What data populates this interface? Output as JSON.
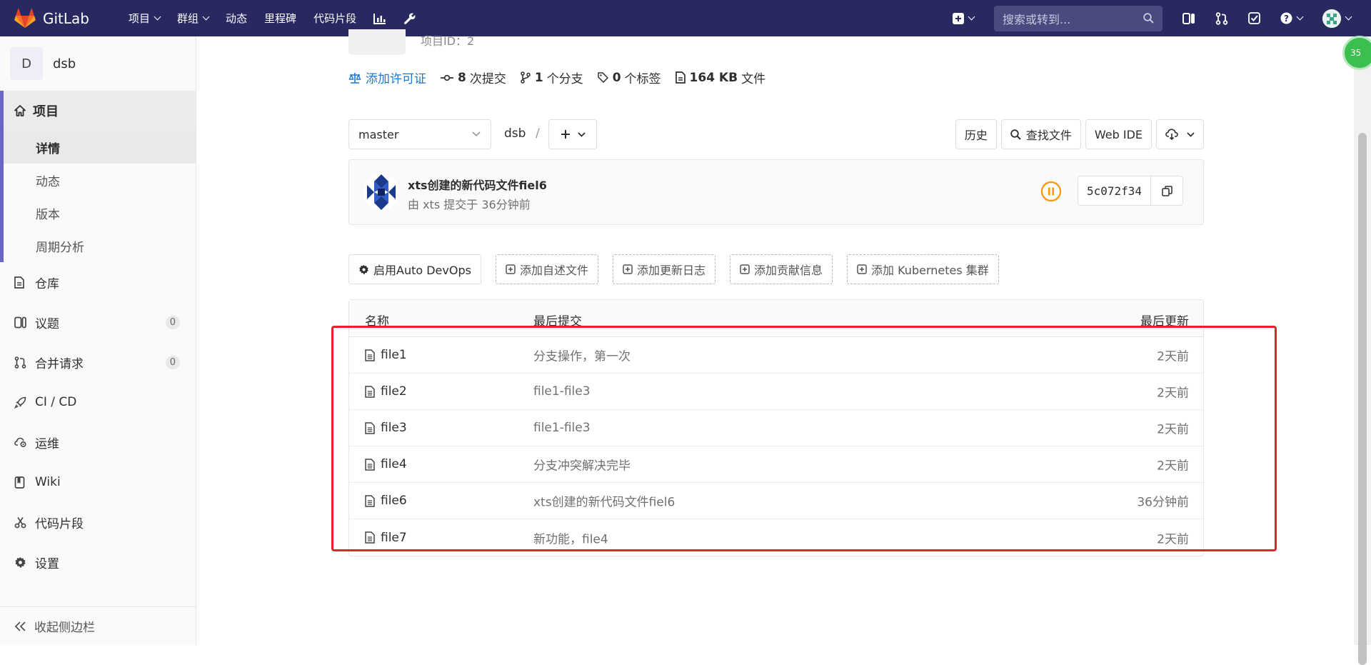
{
  "navbar": {
    "brand": "GitLab",
    "items": [
      {
        "label": "项目",
        "dropdown": true
      },
      {
        "label": "群组",
        "dropdown": true
      },
      {
        "label": "动态",
        "dropdown": false
      },
      {
        "label": "里程碑",
        "dropdown": false
      },
      {
        "label": "代码片段",
        "dropdown": false
      }
    ],
    "search_placeholder": "搜索或转到..."
  },
  "sidebar": {
    "project_initial": "D",
    "project_name": "dsb",
    "section": "项目",
    "subitems": [
      "详情",
      "动态",
      "版本",
      "周期分析"
    ],
    "items": [
      {
        "label": "仓库",
        "icon": "doc-icon"
      },
      {
        "label": "议题",
        "icon": "issues-icon",
        "count": "0"
      },
      {
        "label": "合并请求",
        "icon": "merge-request-icon",
        "count": "0"
      },
      {
        "label": "CI / CD",
        "icon": "rocket-icon"
      },
      {
        "label": "运维",
        "icon": "cloud-gear-icon"
      },
      {
        "label": "Wiki",
        "icon": "book-icon"
      },
      {
        "label": "代码片段",
        "icon": "scissors-icon"
      },
      {
        "label": "设置",
        "icon": "gear-icon"
      }
    ],
    "collapse": "收起侧边栏"
  },
  "project": {
    "id_label": "项目ID：2",
    "license_link": "添加许可证",
    "commits_count": "8",
    "commits_label": "次提交",
    "branches_count": "1",
    "branches_label": "个分支",
    "tags_count": "0",
    "tags_label": "个标签",
    "size_value": "164 KB",
    "size_label": "文件"
  },
  "toolbar": {
    "branch": "master",
    "path": "dsb",
    "separator": "/",
    "history": "历史",
    "find_file": "查找文件",
    "web_ide": "Web IDE"
  },
  "commit": {
    "title": "xts创建的新代码文件fiel6",
    "meta": "由 xts 提交于 36分钟前",
    "sha": "5c072f34",
    "pipeline_color": "#fc9403"
  },
  "actions": [
    {
      "label": "启用Auto DevOps",
      "style": "solid",
      "icon": "gear-icon"
    },
    {
      "label": "添加自述文件",
      "style": "dashed",
      "icon": "plus-square-icon"
    },
    {
      "label": "添加更新日志",
      "style": "dashed",
      "icon": "plus-square-icon"
    },
    {
      "label": "添加贡献信息",
      "style": "dashed",
      "icon": "plus-square-icon"
    },
    {
      "label": "添加 Kubernetes 集群",
      "style": "dashed",
      "icon": "plus-square-icon"
    }
  ],
  "tree": {
    "headers": {
      "name": "名称",
      "commit": "最后提交",
      "date": "最后更新"
    },
    "rows": [
      {
        "name": "file1",
        "commit": "分支操作，第一次",
        "date": "2天前"
      },
      {
        "name": "file2",
        "commit": "file1-file3",
        "date": "2天前"
      },
      {
        "name": "file3",
        "commit": "file1-file3",
        "date": "2天前"
      },
      {
        "name": "file4",
        "commit": "分支冲突解决完毕",
        "date": "2天前"
      },
      {
        "name": "file6",
        "commit": "xts创建的新代码文件fiel6",
        "date": "36分钟前"
      },
      {
        "name": "file7",
        "commit": "新功能，file4",
        "date": "2天前"
      }
    ]
  },
  "badge": "35",
  "colors": {
    "navbar": "#292961",
    "accent": "#6666c4",
    "link": "#1f78d1",
    "highlight": "#e0242a"
  }
}
